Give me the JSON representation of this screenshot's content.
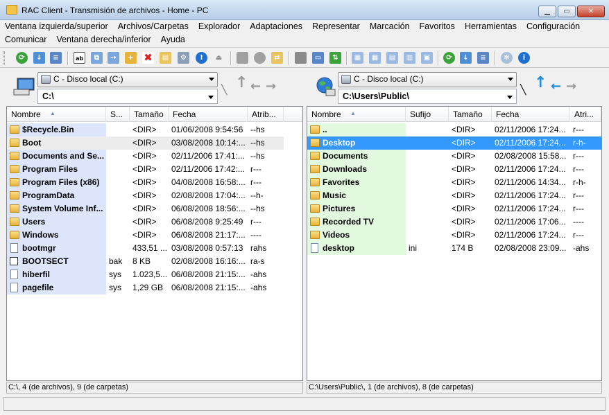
{
  "window": {
    "title": "RAC Client - Transmisión de archivos - Home - PC"
  },
  "menu": {
    "row1": [
      "Ventana izquierda/superior",
      "Archivos/Carpetas",
      "Explorador",
      "Adaptaciones",
      "Representar",
      "Marcación",
      "Favoritos",
      "Herramientas",
      "Configuración"
    ],
    "row2": [
      "Comunicar",
      "Ventana derecha/inferior",
      "Ayuda"
    ]
  },
  "left": {
    "drive": "C - Disco local (C:)",
    "path": "C:\\",
    "columns": [
      "Nombre",
      "S...",
      "Tamaño",
      "Fecha",
      "Atrib..."
    ],
    "rows": [
      {
        "name": "$Recycle.Bin",
        "suffix": "",
        "size": "<DIR>",
        "date": "01/06/2008 9:54:56",
        "attr": "--hs",
        "type": "folder"
      },
      {
        "name": "Boot",
        "suffix": "",
        "size": "<DIR>",
        "date": "03/08/2008 10:14:...",
        "attr": "--hs",
        "type": "folder"
      },
      {
        "name": "Documents and Se...",
        "suffix": "",
        "size": "<DIR>",
        "date": "02/11/2006 17:41:...",
        "attr": "--hs",
        "type": "folder"
      },
      {
        "name": "Program Files",
        "suffix": "",
        "size": "<DIR>",
        "date": "02/11/2006 17:42:...",
        "attr": "r---",
        "type": "folder"
      },
      {
        "name": "Program Files (x86)",
        "suffix": "",
        "size": "<DIR>",
        "date": "04/08/2008 16:58:...",
        "attr": "r---",
        "type": "folder"
      },
      {
        "name": "ProgramData",
        "suffix": "",
        "size": "<DIR>",
        "date": "02/08/2008 17:04:...",
        "attr": "--h-",
        "type": "folder"
      },
      {
        "name": "System Volume Inf...",
        "suffix": "",
        "size": "<DIR>",
        "date": "06/08/2008 18:56:...",
        "attr": "--hs",
        "type": "folder"
      },
      {
        "name": "Users",
        "suffix": "",
        "size": "<DIR>",
        "date": "06/08/2008 9:25:49",
        "attr": "r---",
        "type": "folder"
      },
      {
        "name": "Windows",
        "suffix": "",
        "size": "<DIR>",
        "date": "06/08/2008 21:17:...",
        "attr": "----",
        "type": "folder"
      },
      {
        "name": "bootmgr",
        "suffix": "",
        "size": "433,51 ...",
        "date": "03/08/2008 0:57:13",
        "attr": "rahs",
        "type": "file"
      },
      {
        "name": "BOOTSECT",
        "suffix": "bak",
        "size": "8 KB",
        "date": "02/08/2008 16:16:...",
        "attr": "ra-s",
        "type": "sys"
      },
      {
        "name": "hiberfil",
        "suffix": "sys",
        "size": "1.023,5...",
        "date": "06/08/2008 21:15:...",
        "attr": "-ahs",
        "type": "file"
      },
      {
        "name": "pagefile",
        "suffix": "sys",
        "size": "1,29 GB",
        "date": "06/08/2008 21:15:...",
        "attr": "-ahs",
        "type": "file"
      }
    ],
    "status": "C:\\, 4 (de archivos), 9 (de carpetas)"
  },
  "right": {
    "drive": "C - Disco local (C:)",
    "path": "C:\\Users\\Public\\",
    "columns": [
      "Nombre",
      "Sufijo",
      "Tamaño",
      "Fecha",
      "Atri..."
    ],
    "rows": [
      {
        "name": "..",
        "suffix": "",
        "size": "<DIR>",
        "date": "02/11/2006 17:24...",
        "attr": "r---",
        "type": "folder"
      },
      {
        "name": "Desktop",
        "suffix": "",
        "size": "<DIR>",
        "date": "02/11/2006 17:24...",
        "attr": "r-h-",
        "type": "folder"
      },
      {
        "name": "Documents",
        "suffix": "",
        "size": "<DIR>",
        "date": "02/08/2008 15:58...",
        "attr": "r---",
        "type": "folder"
      },
      {
        "name": "Downloads",
        "suffix": "",
        "size": "<DIR>",
        "date": "02/11/2006 17:24...",
        "attr": "r---",
        "type": "folder"
      },
      {
        "name": "Favorites",
        "suffix": "",
        "size": "<DIR>",
        "date": "02/11/2006 14:34...",
        "attr": "r-h-",
        "type": "folder"
      },
      {
        "name": "Music",
        "suffix": "",
        "size": "<DIR>",
        "date": "02/11/2006 17:24...",
        "attr": "r---",
        "type": "folder"
      },
      {
        "name": "Pictures",
        "suffix": "",
        "size": "<DIR>",
        "date": "02/11/2006 17:24...",
        "attr": "r---",
        "type": "folder"
      },
      {
        "name": "Recorded TV",
        "suffix": "",
        "size": "<DIR>",
        "date": "02/11/2006 17:06...",
        "attr": "----",
        "type": "folder"
      },
      {
        "name": "Videos",
        "suffix": "",
        "size": "<DIR>",
        "date": "02/11/2006 17:24...",
        "attr": "r---",
        "type": "folder"
      },
      {
        "name": "desktop",
        "suffix": "ini",
        "size": "174 B",
        "date": "02/08/2008 23:09...",
        "attr": "-ahs",
        "type": "file"
      }
    ],
    "status": "C:\\Users\\Public\\, 1 (de archivos), 8 (de carpetas)"
  },
  "colors": {
    "left_name_highlight": "#dde5fb",
    "right_name_highlight": "#e2f8df",
    "selection": "#3399ff"
  }
}
